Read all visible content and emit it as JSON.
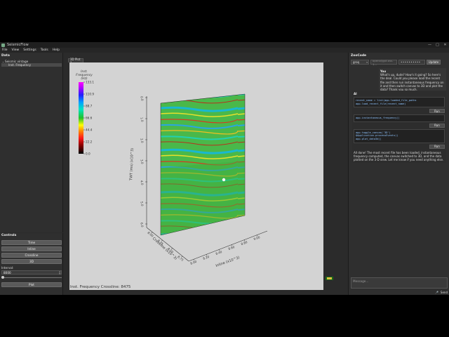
{
  "window": {
    "title": "SeismicFlow",
    "controls": [
      "—",
      "□",
      "✕"
    ]
  },
  "menu": [
    "File",
    "View",
    "Settings",
    "Tools",
    "Help"
  ],
  "data_panel": {
    "title": "Data",
    "items": [
      {
        "label": "Seismic vintage",
        "chevron": "⌄"
      },
      {
        "label": "Inst. Frequency",
        "selected": true
      }
    ]
  },
  "controls_panel": {
    "title": "Controls",
    "buttons": [
      "Time",
      "Inline",
      "Crossline",
      "3D"
    ],
    "interval_label": "Interval:",
    "interval_value": "8000",
    "slider_fraction": 0.0,
    "plot_label": "Plot"
  },
  "center": {
    "tab": "3D Plot 1",
    "caption": "Inst. Frequency Crossline: 8475",
    "colorbar": {
      "title_line1": "Inst.",
      "title_line2": "Frequency",
      "title_line3": "(Hz)",
      "ticks": [
        "133.1",
        "110.9",
        "88.7",
        "66.6",
        "44.4",
        "22.2",
        "0.0"
      ]
    },
    "axis_twt": {
      "label": "TWT (ms) (x10^3)",
      "ticks": [
        "0.0",
        "1.0",
        "2.0",
        "3.0",
        "4.0",
        "5.0",
        "6.0"
      ]
    },
    "axis_crossline": {
      "label": "Crossline (x10^3)",
      "ticks": [
        "8.00",
        "8.25",
        "8.50",
        "8.75"
      ]
    },
    "axis_inline": {
      "label": "Inline (x10^3)",
      "ticks": [
        "8.00",
        "8.20",
        "8.40",
        "8.60",
        "8.80",
        "9.00"
      ]
    }
  },
  "right_panel": {
    "title": "ZooCode",
    "model": "groq",
    "key_placeholder": "openai/gpt-oss-1...",
    "password_mask": "••••••••••",
    "update_label": "Update",
    "user_name": "You",
    "user_message": "What's up, dude? How's it going? So here's the deal. Could you please load the recent file and then run instantaneous frequency on it and then switch canvas to 3D and plot the data? Thank you so much.",
    "ai_name": "AI",
    "code_blocks": [
      "recent_name = list(app.loaded_file_paths\napp.load_recent_file(recent_name)",
      "app.instantaneous_frequency()",
      "app.toggle_canvas('3D')\nQApplication.processEvents()\napp.plot_data3d()"
    ],
    "run_label": "Run",
    "ai_message": "All done! The most recent file has been loaded, instantaneous frequency computed, the canvas switched to 3D, and the data plotted on the 3-D view. Let me know if you need anything else.",
    "input_placeholder": "Message...",
    "mic_icon": "mic-icon",
    "send_label": "Send"
  }
}
